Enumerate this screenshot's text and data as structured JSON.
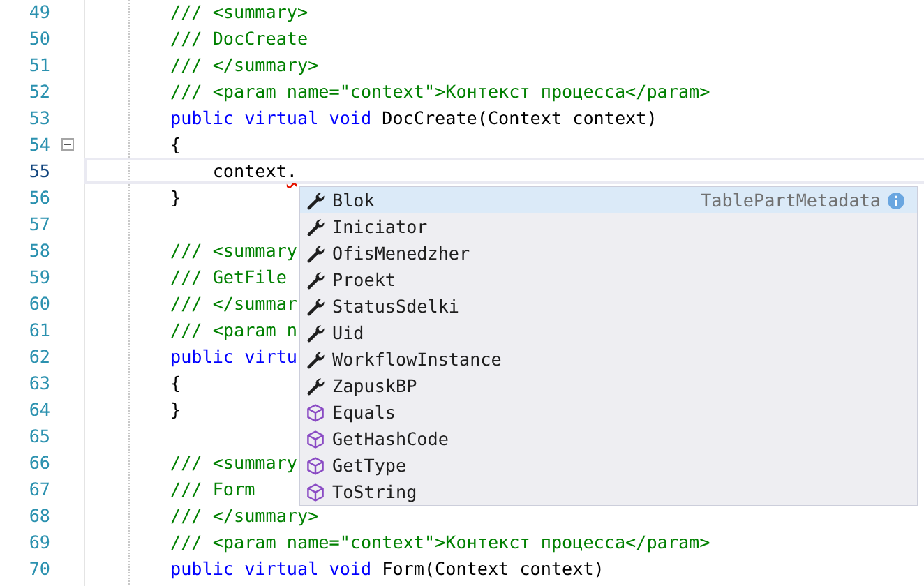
{
  "editor": {
    "lines": [
      {
        "number": "49",
        "current": false,
        "tokens": [
          {
            "kind": "comment",
            "text": "/// <summary>"
          }
        ]
      },
      {
        "number": "50",
        "current": false,
        "tokens": [
          {
            "kind": "comment",
            "text": "/// DocCreate"
          }
        ]
      },
      {
        "number": "51",
        "current": false,
        "tokens": [
          {
            "kind": "comment",
            "text": "/// </summary>"
          }
        ]
      },
      {
        "number": "52",
        "current": false,
        "tokens": [
          {
            "kind": "comment",
            "text": "/// <param name=\"context\">Контекст процесса</param>"
          }
        ]
      },
      {
        "number": "53",
        "current": false,
        "tokens": [
          {
            "kind": "keyword",
            "text": "public virtual void"
          },
          {
            "kind": "plain",
            "text": " DocCreate(Context context)"
          }
        ]
      },
      {
        "number": "54",
        "current": false,
        "fold": {
          "expanded": true
        },
        "tokens": [
          {
            "kind": "plain",
            "text": "{"
          }
        ]
      },
      {
        "number": "55",
        "current": true,
        "tokens": [
          {
            "kind": "plain",
            "text": "    context"
          },
          {
            "kind": "error",
            "text": "."
          }
        ]
      },
      {
        "number": "56",
        "current": false,
        "tokens": [
          {
            "kind": "plain",
            "text": "}"
          }
        ]
      },
      {
        "number": "57",
        "current": false
      },
      {
        "number": "58",
        "current": false,
        "tokens": [
          {
            "kind": "comment",
            "text": "/// <summary"
          }
        ]
      },
      {
        "number": "59",
        "current": false,
        "tokens": [
          {
            "kind": "comment",
            "text": "/// GetFile"
          }
        ]
      },
      {
        "number": "60",
        "current": false,
        "tokens": [
          {
            "kind": "comment",
            "text": "/// </summar"
          }
        ]
      },
      {
        "number": "61",
        "current": false,
        "tokens": [
          {
            "kind": "comment",
            "text": "/// <param n"
          }
        ]
      },
      {
        "number": "62",
        "current": false,
        "tokens": [
          {
            "kind": "keyword",
            "text": "public virtu"
          }
        ]
      },
      {
        "number": "63",
        "current": false,
        "tokens": [
          {
            "kind": "plain",
            "text": "{"
          }
        ]
      },
      {
        "number": "64",
        "current": false,
        "tokens": [
          {
            "kind": "plain",
            "text": "}"
          }
        ]
      },
      {
        "number": "65",
        "current": false
      },
      {
        "number": "66",
        "current": false,
        "tokens": [
          {
            "kind": "comment",
            "text": "/// <summary"
          }
        ]
      },
      {
        "number": "67",
        "current": false,
        "tokens": [
          {
            "kind": "comment",
            "text": "/// Form"
          }
        ]
      },
      {
        "number": "68",
        "current": false,
        "tokens": [
          {
            "kind": "comment",
            "text": "/// </summary>"
          }
        ]
      },
      {
        "number": "69",
        "current": false,
        "tokens": [
          {
            "kind": "comment",
            "text": "/// <param name=\"context\">Контекст процесса</param>"
          }
        ]
      },
      {
        "number": "70",
        "current": false,
        "tokens": [
          {
            "kind": "keyword",
            "text": "public virtual void"
          },
          {
            "kind": "plain",
            "text": " Form(Context context)"
          }
        ]
      }
    ]
  },
  "completion": {
    "items": [
      {
        "label": "Blok",
        "kind": "property",
        "selected": true,
        "detail": "TablePartMetadata"
      },
      {
        "label": "Iniciator",
        "kind": "property",
        "selected": false
      },
      {
        "label": "OfisMenedzher",
        "kind": "property",
        "selected": false
      },
      {
        "label": "Proekt",
        "kind": "property",
        "selected": false
      },
      {
        "label": "StatusSdelki",
        "kind": "property",
        "selected": false
      },
      {
        "label": "Uid",
        "kind": "property",
        "selected": false
      },
      {
        "label": "WorkflowInstance",
        "kind": "property",
        "selected": false
      },
      {
        "label": "ZapuskBP",
        "kind": "property",
        "selected": false
      },
      {
        "label": "Equals",
        "kind": "method",
        "selected": false
      },
      {
        "label": "GetHashCode",
        "kind": "method",
        "selected": false
      },
      {
        "label": "GetType",
        "kind": "method",
        "selected": false
      },
      {
        "label": "ToString",
        "kind": "method",
        "selected": false
      }
    ]
  }
}
